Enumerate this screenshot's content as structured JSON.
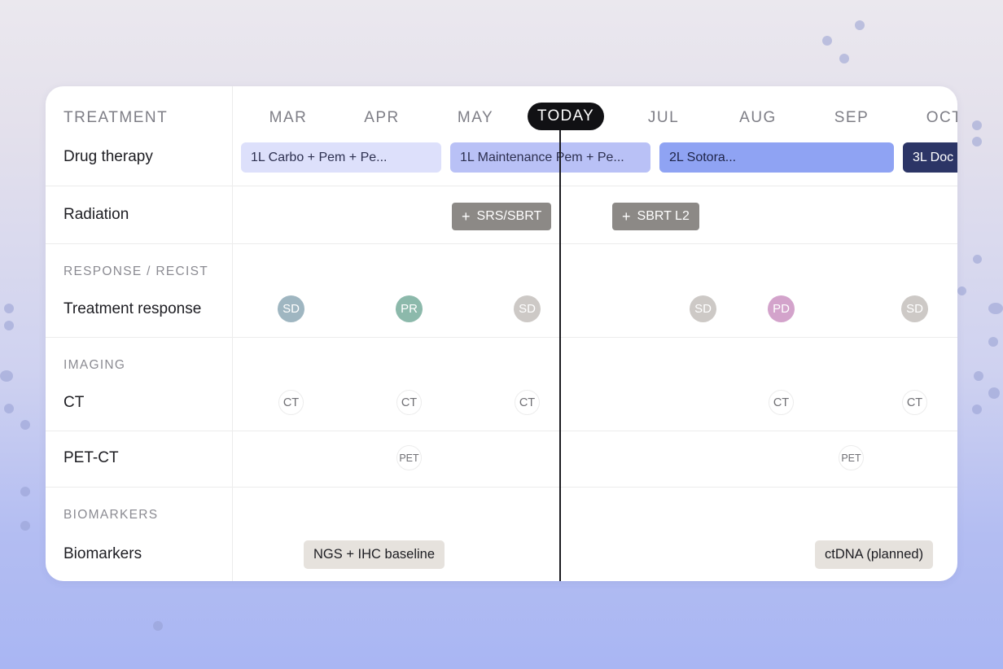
{
  "header": {
    "treatment": "TREATMENT"
  },
  "months": [
    "MAR",
    "APR",
    "MAY",
    "JUL",
    "AUG",
    "SEP",
    "OCT"
  ],
  "today_label": "TODAY",
  "rows": {
    "drug_therapy": "Drug therapy",
    "radiation": "Radiation",
    "treatment_response": "Treatment response",
    "ct": "CT",
    "pet_ct": "PET-CT",
    "biomarkers": "Biomarkers"
  },
  "sections": {
    "response": "RESPONSE / RECIST",
    "imaging": "IMAGING",
    "biomarkers": "BIOMARKERS"
  },
  "drug_bars": [
    {
      "label": "1L Carbo + Pem + Pe...",
      "color": "#dde0fb",
      "text_color": "#2d3050"
    },
    {
      "label": "1L Maintenance Pem + Pe...",
      "color": "#b9c1f6",
      "text_color": "#2d3050"
    },
    {
      "label": "2L Sotora...",
      "color": "#8fa3f3",
      "text_color": "#1e2448"
    },
    {
      "label": "3L Doc",
      "color": "#2c3566",
      "text_color": "#ffffff"
    }
  ],
  "radiation_items": [
    {
      "icon": "plus-icon",
      "plus": "+",
      "label": "SRS/SBRT"
    },
    {
      "icon": "plus-icon",
      "plus": "+",
      "label": "SBRT L2"
    }
  ],
  "responses": [
    {
      "label": "SD",
      "color": "#9fb6c1"
    },
    {
      "label": "PR",
      "color": "#8cb9ab"
    },
    {
      "label": "SD",
      "color": "#cdc9c6"
    },
    {
      "label": "SD",
      "color": "#cdc9c6"
    },
    {
      "label": "PD",
      "color": "#d3a3cb"
    },
    {
      "label": "SD",
      "color": "#cdc9c6"
    }
  ],
  "ct_scans": [
    "CT",
    "CT",
    "CT",
    "CT",
    "CT"
  ],
  "pet_scans": [
    "PET",
    "PET"
  ],
  "biomarker_tests": [
    "NGS + IHC baseline",
    "ctDNA (planned)"
  ]
}
